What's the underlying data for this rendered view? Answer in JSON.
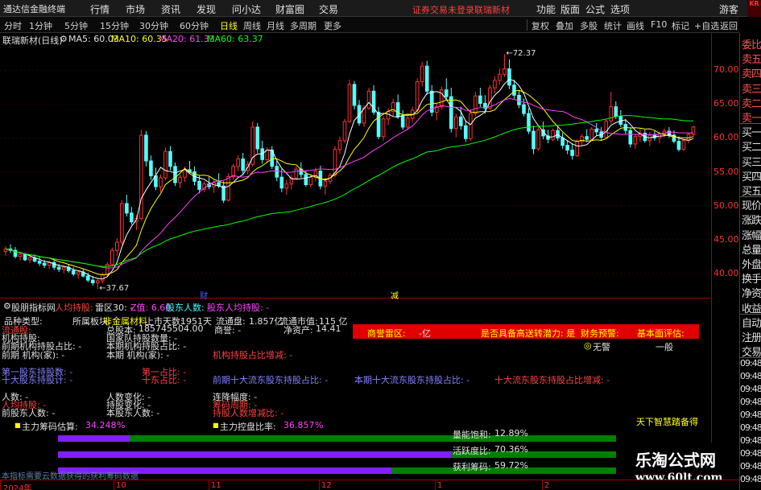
{
  "menubar": {
    "app_title": "通达信金融终端",
    "menus": [
      "行情",
      "市场",
      "资讯",
      "发现",
      "问小达",
      "财富圈",
      "交易"
    ],
    "status_text": "证券交易未登录",
    "stock_name": "联瑞新材",
    "right_menus": [
      "功能",
      "版面",
      "公式",
      "选项"
    ],
    "guest": "游客",
    "logo": "KR"
  },
  "periodbar": {
    "periods": [
      "分时",
      "1分钟",
      "5分钟",
      "15分钟",
      "30分钟",
      "60分钟",
      "日线",
      "周线",
      "月线",
      "多周期",
      "更多"
    ],
    "active": "日线",
    "tools": [
      "复权",
      "叠加",
      "多股",
      "统计",
      "画线",
      "F10",
      "标记",
      "+自选",
      "返回"
    ]
  },
  "legend": {
    "title": "联瑞新材(日线)",
    "ma5": "MA5: 60.03",
    "ma10": "MA10: 60.35",
    "ma20": "MA20: 61.33",
    "ma60": "MA60: 63.37"
  },
  "colors": {
    "up": "#ff3030",
    "down": "#54ffff",
    "ma5": "#ffffff",
    "ma10": "#ffff00",
    "ma20": "#ff40ff",
    "ma60": "#00ff00",
    "axis": "#a00000"
  },
  "chart_data": {
    "type": "candlestick",
    "title": "联瑞新材(日线)",
    "ylim": [
      37,
      73
    ],
    "yticks": [
      "70.00",
      "65.00",
      "60.00",
      "55.00",
      "50.00",
      "45.00",
      "40.00"
    ],
    "ytick_values": [
      70,
      65,
      60,
      55,
      50,
      45,
      40
    ],
    "high_label": "72.37",
    "low_label": "37.67",
    "markers": [
      "财",
      "减"
    ],
    "ohlc": [
      [
        43.2,
        44.0,
        42.6,
        43.6
      ],
      [
        43.6,
        44.3,
        43.0,
        43.4
      ],
      [
        43.4,
        43.9,
        42.2,
        42.5
      ],
      [
        42.5,
        43.1,
        41.9,
        42.8
      ],
      [
        42.8,
        43.0,
        41.8,
        42.0
      ],
      [
        42.0,
        42.6,
        41.5,
        42.3
      ],
      [
        42.3,
        42.8,
        41.6,
        41.8
      ],
      [
        41.8,
        42.4,
        41.1,
        41.5
      ],
      [
        41.5,
        42.0,
        40.8,
        41.2
      ],
      [
        41.2,
        41.8,
        40.6,
        41.6
      ],
      [
        41.6,
        41.9,
        40.5,
        40.9
      ],
      [
        40.9,
        41.4,
        40.2,
        40.6
      ],
      [
        40.6,
        41.2,
        40.0,
        40.9
      ],
      [
        40.9,
        41.3,
        40.1,
        40.4
      ],
      [
        40.4,
        40.9,
        39.6,
        39.9
      ],
      [
        39.9,
        40.4,
        39.2,
        40.2
      ],
      [
        40.2,
        40.6,
        39.4,
        39.6
      ],
      [
        39.6,
        40.1,
        38.7,
        39.0
      ],
      [
        39.0,
        39.6,
        38.2,
        38.6
      ],
      [
        38.6,
        39.2,
        37.7,
        38.9
      ],
      [
        38.9,
        40.1,
        38.5,
        39.8
      ],
      [
        39.8,
        41.6,
        39.5,
        41.3
      ],
      [
        41.3,
        43.8,
        41.0,
        43.4
      ],
      [
        43.4,
        45.2,
        42.6,
        44.6
      ],
      [
        44.6,
        50.8,
        44.2,
        50.3
      ],
      [
        50.3,
        51.6,
        48.4,
        48.9
      ],
      [
        48.9,
        49.8,
        47.2,
        47.6
      ],
      [
        47.6,
        48.6,
        46.4,
        48.1
      ],
      [
        48.1,
        61.2,
        47.9,
        60.4
      ],
      [
        60.4,
        61.0,
        55.8,
        56.6
      ],
      [
        56.6,
        57.4,
        53.8,
        54.4
      ],
      [
        54.4,
        55.6,
        52.3,
        52.8
      ],
      [
        52.8,
        54.6,
        52.0,
        54.1
      ],
      [
        54.1,
        58.6,
        53.8,
        58.0
      ],
      [
        58.0,
        58.8,
        55.2,
        55.8
      ],
      [
        55.8,
        56.4,
        52.9,
        53.4
      ],
      [
        53.4,
        54.6,
        52.6,
        54.2
      ],
      [
        54.2,
        55.8,
        53.5,
        55.3
      ],
      [
        55.3,
        56.6,
        54.8,
        55.0
      ],
      [
        55.0,
        55.8,
        53.0,
        53.6
      ],
      [
        53.6,
        54.4,
        51.8,
        52.4
      ],
      [
        52.4,
        53.6,
        52.0,
        53.2
      ],
      [
        53.2,
        54.3,
        52.4,
        52.8
      ],
      [
        52.8,
        53.9,
        51.9,
        53.4
      ],
      [
        53.4,
        54.8,
        52.6,
        52.9
      ],
      [
        52.9,
        53.6,
        50.4,
        50.8
      ],
      [
        50.8,
        54.8,
        50.6,
        54.3
      ],
      [
        54.3,
        56.2,
        53.8,
        55.8
      ],
      [
        55.8,
        57.4,
        55.1,
        56.9
      ],
      [
        56.9,
        57.8,
        54.6,
        55.2
      ],
      [
        55.2,
        56.6,
        54.6,
        56.1
      ],
      [
        56.1,
        62.4,
        55.8,
        61.6
      ],
      [
        61.6,
        62.2,
        57.8,
        58.4
      ],
      [
        58.4,
        59.6,
        56.2,
        56.8
      ],
      [
        56.8,
        58.6,
        56.3,
        58.2
      ],
      [
        58.2,
        58.8,
        55.4,
        55.8
      ],
      [
        55.8,
        56.6,
        53.6,
        54.2
      ],
      [
        54.2,
        55.4,
        52.0,
        52.6
      ],
      [
        52.6,
        53.8,
        51.6,
        53.2
      ],
      [
        53.2,
        54.6,
        52.4,
        54.1
      ],
      [
        54.1,
        55.8,
        53.8,
        55.4
      ],
      [
        55.4,
        56.4,
        54.1,
        54.6
      ],
      [
        54.6,
        55.2,
        52.8,
        53.1
      ],
      [
        53.1,
        54.6,
        52.7,
        54.2
      ],
      [
        54.2,
        55.6,
        53.6,
        55.1
      ],
      [
        55.1,
        55.9,
        52.4,
        52.9
      ],
      [
        52.9,
        54.1,
        51.6,
        53.6
      ],
      [
        53.6,
        54.8,
        53.2,
        54.5
      ],
      [
        54.5,
        58.8,
        54.2,
        58.3
      ],
      [
        58.3,
        60.2,
        57.6,
        59.6
      ],
      [
        59.6,
        62.8,
        59.2,
        62.4
      ],
      [
        62.4,
        68.6,
        62.2,
        67.9
      ],
      [
        67.9,
        68.4,
        64.2,
        64.8
      ],
      [
        64.8,
        65.6,
        61.8,
        62.2
      ],
      [
        62.2,
        64.8,
        61.6,
        64.4
      ],
      [
        64.4,
        67.4,
        64.1,
        66.9
      ],
      [
        66.9,
        67.8,
        63.4,
        63.8
      ],
      [
        63.8,
        64.6,
        59.8,
        60.2
      ],
      [
        60.2,
        63.2,
        59.6,
        62.8
      ],
      [
        62.8,
        64.4,
        61.9,
        63.9
      ],
      [
        63.9,
        65.8,
        63.2,
        65.2
      ],
      [
        65.2,
        66.4,
        62.8,
        63.2
      ],
      [
        63.2,
        64.1,
        61.2,
        61.6
      ],
      [
        61.6,
        63.4,
        61.1,
        62.9
      ],
      [
        62.9,
        64.6,
        62.4,
        64.1
      ],
      [
        64.1,
        68.8,
        63.8,
        68.3
      ],
      [
        68.3,
        71.2,
        67.6,
        70.6
      ],
      [
        70.6,
        71.4,
        66.4,
        66.9
      ],
      [
        66.9,
        67.8,
        63.2,
        63.8
      ],
      [
        63.8,
        65.1,
        62.6,
        64.6
      ],
      [
        64.6,
        67.6,
        64.2,
        67.1
      ],
      [
        67.1,
        68.8,
        65.6,
        66.1
      ],
      [
        66.1,
        67.4,
        60.8,
        61.4
      ],
      [
        61.4,
        63.6,
        60.1,
        63.1
      ],
      [
        63.1,
        64.6,
        61.2,
        61.8
      ],
      [
        61.8,
        62.6,
        59.4,
        59.9
      ],
      [
        59.9,
        64.2,
        59.6,
        63.6
      ],
      [
        63.6,
        66.8,
        63.2,
        66.2
      ],
      [
        66.2,
        67.4,
        64.6,
        65.1
      ],
      [
        65.1,
        66.3,
        63.6,
        64.4
      ],
      [
        64.4,
        67.8,
        64.1,
        67.4
      ],
      [
        67.4,
        69.1,
        66.6,
        68.5
      ],
      [
        68.5,
        70.2,
        67.9,
        69.4
      ],
      [
        69.4,
        72.37,
        69.0,
        70.2
      ],
      [
        70.2,
        71.6,
        67.2,
        67.8
      ],
      [
        67.8,
        68.6,
        65.8,
        66.3
      ],
      [
        66.3,
        67.1,
        64.4,
        64.9
      ],
      [
        64.9,
        65.8,
        63.2,
        63.6
      ],
      [
        63.6,
        64.4,
        60.6,
        61.0
      ],
      [
        61.0,
        61.8,
        57.6,
        58.4
      ],
      [
        58.4,
        61.6,
        58.1,
        61.2
      ],
      [
        61.2,
        62.4,
        59.8,
        60.3
      ],
      [
        60.3,
        61.2,
        59.2,
        59.8
      ],
      [
        59.8,
        61.4,
        59.5,
        61.1
      ],
      [
        61.1,
        61.8,
        59.6,
        60.0
      ],
      [
        60.0,
        60.8,
        58.4,
        58.9
      ],
      [
        58.9,
        59.6,
        57.6,
        58.2
      ],
      [
        58.2,
        59.2,
        56.8,
        57.4
      ],
      [
        57.4,
        59.8,
        57.2,
        59.5
      ],
      [
        59.5,
        60.6,
        58.8,
        60.2
      ],
      [
        60.2,
        61.3,
        59.4,
        59.8
      ],
      [
        59.8,
        61.6,
        59.6,
        61.3
      ],
      [
        61.3,
        62.2,
        60.4,
        60.9
      ],
      [
        60.9,
        61.6,
        59.6,
        60.1
      ],
      [
        60.1,
        62.8,
        59.9,
        62.5
      ],
      [
        62.5,
        66.8,
        62.1,
        64.6
      ],
      [
        64.6,
        65.4,
        62.8,
        63.2
      ],
      [
        63.2,
        64.1,
        61.6,
        62.0
      ],
      [
        62.0,
        62.8,
        60.6,
        61.1
      ],
      [
        61.1,
        61.6,
        58.6,
        59.1
      ],
      [
        59.1,
        60.6,
        58.4,
        60.2
      ],
      [
        60.2,
        61.4,
        59.4,
        60.7
      ],
      [
        60.7,
        61.2,
        59.3,
        59.6
      ],
      [
        59.6,
        60.9,
        58.8,
        60.4
      ],
      [
        60.4,
        61.0,
        59.6,
        60.0
      ],
      [
        60.0,
        60.9,
        59.2,
        60.6
      ],
      [
        60.6,
        61.4,
        60.1,
        61.0
      ],
      [
        61.0,
        61.6,
        60.0,
        60.4
      ],
      [
        60.4,
        61.1,
        59.2,
        59.5
      ],
      [
        59.5,
        60.2,
        58.0,
        58.3
      ],
      [
        58.3,
        59.8,
        58.1,
        59.6
      ],
      [
        59.6,
        60.8,
        59.2,
        60.5
      ],
      [
        60.5,
        61.8,
        60.2,
        61.6
      ]
    ]
  },
  "lower": {
    "indicator_name": "股朋指标网",
    "items": [
      "人均持股:",
      "雷区30: -",
      "Z值: 6.60",
      "股东人数: -",
      "股东人均持股: -"
    ],
    "fields": {
      "pinzhong": "品种类型:",
      "suoshu": "所属板块:",
      "bankuai_value": "非金属材料",
      "shangshi": "上市天数:",
      "shangshi_value": "1951天",
      "liutongpan": "流通盘:",
      "liutongpan_value": "1.857亿",
      "liutongshizhi": "流通市值:",
      "liutongshizhi_value": "115 亿",
      "liutonggu": "流通股:",
      "zongguben": "总股本:",
      "zongguben_value": "185745504.00",
      "shangyu": "商誉: -",
      "jingzichan": "净资产:",
      "jingzichan_value": "14.41",
      "jigou_chigu": "机构持股:",
      "guojia": "国家队持股数量: -",
      "qianqi_jigou": "前期机构持股占比: -",
      "benqi_jigou": "本期机构持股占比: -",
      "qianqi_jigou_jia": "前期 机构(家): -",
      "benqi_jigou_jia": "本期 机构(家): -",
      "jigou_zengjian": "机构持股占比增减: -",
      "diyi_gudong": "第一股东持股数: -",
      "diyi_zhanbi": "第一占比: -",
      "shida_gudong": "十大股东持股计: -",
      "shida_zhanbi": "十东占比: -",
      "qianqi_shida": "前期十大流东股东持股占比: -",
      "benqi_shida": "本期十大流东股东持股占比: -",
      "shida_zengjian": "十大流东股东持股占比增减: -",
      "renshu": "人数: -",
      "renshu_bianhua": "人数变化: -",
      "lianjiang": "连降幅度: -",
      "renjun_chigu": "人均持股: -",
      "chigu_bianhua": "持股变化: -",
      "chigu_zhouqi": "筹码周期: -",
      "qianqi_gudong": "前股东人数: -",
      "benqi_gudong": "本股东人数: -",
      "gudong_zengjian": "持股人数增减比: -"
    },
    "redbar": {
      "leiqu": "商誉雷区:",
      "leiqu_value": "-亿",
      "gaosongzhuan": "是否具备高送转潜力: 是",
      "caiwu": "财务预警:",
      "caiwu_value": "无警",
      "jiben": "基本面评估:",
      "jiben_value": "一般"
    },
    "zhuli_chouma": "主力筹码估算:",
    "zhuli_chouma_value": "34.248",
    "zhuli_chouma_unit": "%",
    "zhuli_kongpan": "主力控盘比率:",
    "zhuli_kongpan_value": "36.857",
    "zhuli_kongpan_unit": "%",
    "tianxia": "天下智慧踏备得",
    "bars": [
      {
        "label": "量能饱和:",
        "value": "12.89%",
        "fraction": 0.1289
      },
      {
        "label": "活跃度比:",
        "value": "70.36%",
        "fraction": 0.7036
      },
      {
        "label": "获利筹码:",
        "value": "59.72%",
        "fraction": 0.5972
      }
    ],
    "note": "本指标需要云数据获得的获利筹码数据"
  },
  "dateaxis": {
    "ticks": [
      "2024年",
      "10",
      "11",
      "12",
      "1",
      "2"
    ]
  },
  "rightpanel": {
    "items": [
      "委比",
      "卖五",
      "卖四",
      "卖三",
      "卖二",
      "卖一",
      "买一",
      "买二",
      "买三",
      "买四",
      "买五",
      "现价",
      "涨跌",
      "涨幅",
      "总量",
      "外盘",
      "换手",
      "净资",
      "收益",
      "自动",
      "注册",
      "交易",
      "09:48",
      "09:48",
      "09:48",
      "09:48",
      "09:48",
      "09:48",
      "09:48",
      "09:48",
      "09:48",
      "09:48"
    ]
  },
  "watermark": {
    "main": "乐淘公式网",
    "url": "www.60lt.com"
  }
}
